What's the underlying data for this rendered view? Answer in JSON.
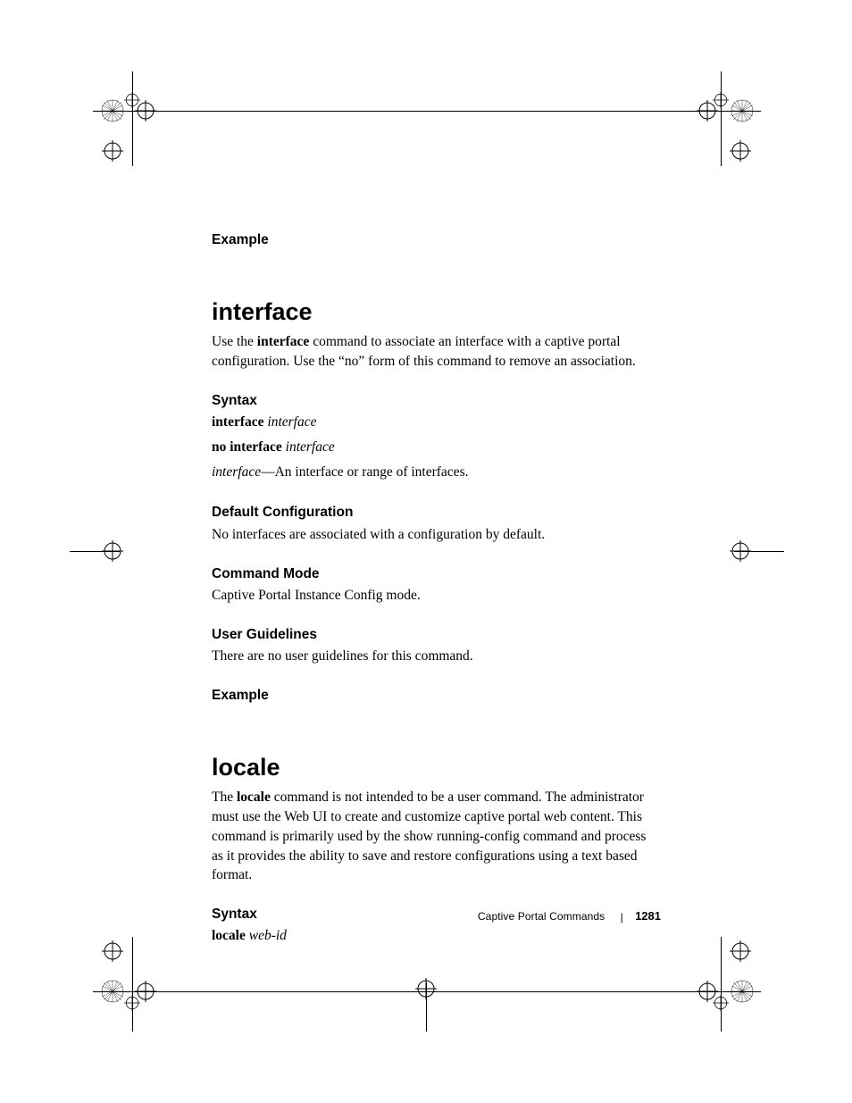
{
  "sections": {
    "interface": {
      "example_label_top": "Example",
      "title": "interface",
      "desc_pre": "Use the ",
      "desc_bold": "interface",
      "desc_post": " command to associate an interface with a captive portal configuration. Use the “no” form of this command to remove an association.",
      "syntax_label": "Syntax",
      "syntax_line1_bold": "interface ",
      "syntax_line1_ital": "interface",
      "syntax_line2_bold": "no interface ",
      "syntax_line2_ital": "interface",
      "syntax_line3_ital": "interface",
      "syntax_line3_rest": "—An interface or range of interfaces.",
      "default_label": "Default Configuration",
      "default_text": "No interfaces are associated with a configuration by default.",
      "mode_label": "Command Mode",
      "mode_text": "Captive Portal Instance Config mode.",
      "guidelines_label": "User Guidelines",
      "guidelines_text": "There are no user guidelines for this command.",
      "example_label_bottom": "Example"
    },
    "locale": {
      "title": "locale",
      "desc_pre": "The ",
      "desc_bold": "locale",
      "desc_post": " command is not intended to be a user command. The administrator must use the Web UI to create and customize captive portal web content. This command is primarily used by the show running-config command and process as it provides the ability to save and restore configurations using a text based format.",
      "syntax_label": "Syntax",
      "syntax_line1_bold": "locale ",
      "syntax_line1_ital": "web-id"
    }
  },
  "footer": {
    "title": "Captive Portal Commands",
    "page": "1281"
  }
}
